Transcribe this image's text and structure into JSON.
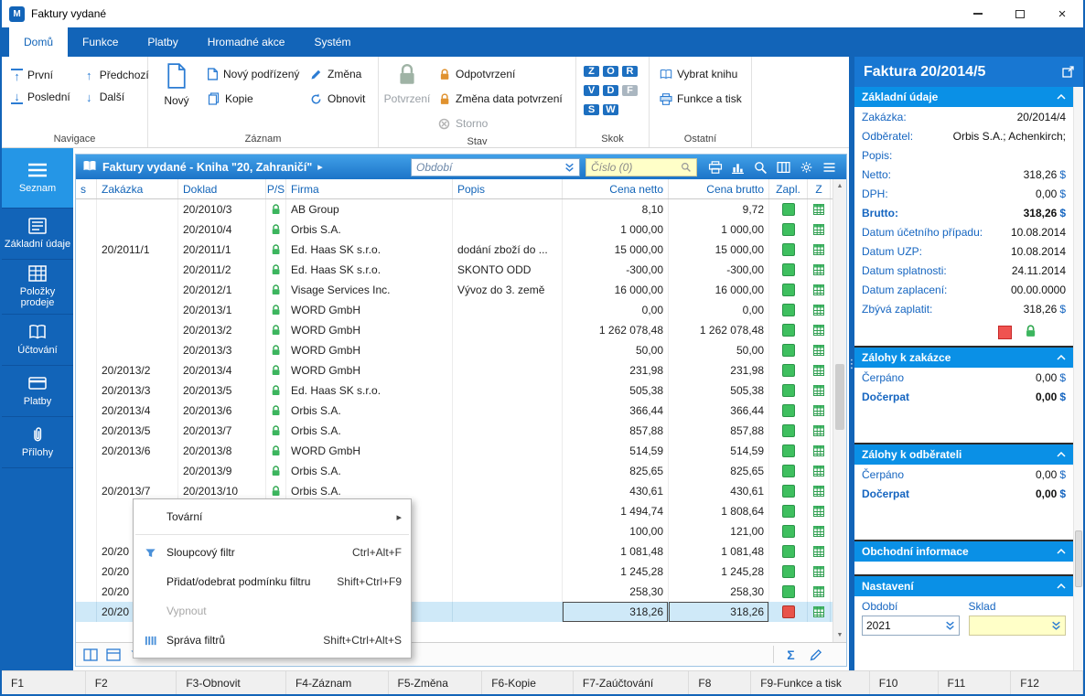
{
  "window": {
    "title": "Faktury vydané",
    "app_icon": "money-app-icon",
    "controls": [
      "minimize-icon",
      "maximize-icon",
      "close-icon"
    ]
  },
  "ribbon_tabs": [
    {
      "label": "Domů",
      "active": true
    },
    {
      "label": "Funkce",
      "active": false
    },
    {
      "label": "Platby",
      "active": false
    },
    {
      "label": "Hromadné akce",
      "active": false
    },
    {
      "label": "Systém",
      "active": false
    }
  ],
  "ribbon": {
    "navigace": {
      "label": "Navigace",
      "prvni": "První",
      "posledni": "Poslední",
      "predchozi": "Předchozí",
      "dalsi": "Další"
    },
    "zaznam": {
      "label": "Záznam",
      "novy": "Nový",
      "novy_podrizeny": "Nový podřízený",
      "kopie": "Kopie",
      "zmena": "Změna",
      "obnovit": "Obnovit"
    },
    "stav": {
      "label": "Stav",
      "potvrzeni": "Potvrzení",
      "odpotvrzeni": "Odpotvrzení",
      "zmena_data": "Změna data potvrzení",
      "storno": "Storno"
    },
    "skok": {
      "label": "Skok",
      "letters": [
        {
          "ch": "Z",
          "disabled": false
        },
        {
          "ch": "O",
          "disabled": false
        },
        {
          "ch": "R",
          "disabled": false
        },
        {
          "ch": "V",
          "disabled": false
        },
        {
          "ch": "D",
          "disabled": false
        },
        {
          "ch": "F",
          "disabled": true
        },
        {
          "ch": "S",
          "disabled": false
        },
        {
          "ch": "W",
          "disabled": false
        }
      ]
    },
    "ostatni": {
      "label": "Ostatní",
      "vybrat_knihu": "Vybrat knihu",
      "funkce_a_tisk": "Funkce a tisk"
    }
  },
  "sidebar": [
    {
      "label": "Seznam",
      "icon": "list-icon",
      "active": true
    },
    {
      "label": "Základní údaje",
      "icon": "form-icon",
      "active": false
    },
    {
      "label": "Položky prodeje",
      "icon": "items-icon",
      "active": false
    },
    {
      "label": "Účtování",
      "icon": "ledger-icon",
      "active": false
    },
    {
      "label": "Platby",
      "icon": "payments-icon",
      "active": false
    },
    {
      "label": "Přílohy",
      "icon": "attachment-icon",
      "active": false
    }
  ],
  "list": {
    "title": "Faktury vydané - Kniha \"20, Zahraničí\"",
    "obdobi_placeholder": "Období",
    "cislo_placeholder": "Číslo (0)",
    "header_icons": [
      "print-icon",
      "chart-icon",
      "find-icon",
      "columns-icon",
      "settings-icon",
      "menu-icon"
    ],
    "columns": [
      "s",
      "Zakázka",
      "Doklad",
      "P/S",
      "Firma",
      "Popis",
      "Cena netto",
      "Cena brutto",
      "Zapl.",
      "Z"
    ],
    "rows": [
      {
        "zakazka": "",
        "doklad": "20/2010/3",
        "locked": true,
        "firma": "AB Group",
        "popis": "",
        "netto": "8,10",
        "brutto": "9,72",
        "zapl": "green",
        "selected": false
      },
      {
        "zakazka": "",
        "doklad": "20/2010/4",
        "locked": true,
        "firma": "Orbis S.A.",
        "popis": "",
        "netto": "1 000,00",
        "brutto": "1 000,00",
        "zapl": "green",
        "selected": false
      },
      {
        "zakazka": "20/2011/1",
        "doklad": "20/2011/1",
        "locked": true,
        "firma": "Ed. Haas SK s.r.o.",
        "popis": "dodání zboží do ...",
        "netto": "15 000,00",
        "brutto": "15 000,00",
        "zapl": "green",
        "selected": false
      },
      {
        "zakazka": "",
        "doklad": "20/2011/2",
        "locked": true,
        "firma": "Ed. Haas SK s.r.o.",
        "popis": "SKONTO ODD",
        "netto": "-300,00",
        "brutto": "-300,00",
        "zapl": "green",
        "selected": false
      },
      {
        "zakazka": "",
        "doklad": "20/2012/1",
        "locked": true,
        "firma": "Visage Services Inc.",
        "popis": "Vývoz do 3. země",
        "netto": "16 000,00",
        "brutto": "16 000,00",
        "zapl": "green",
        "selected": false
      },
      {
        "zakazka": "",
        "doklad": "20/2013/1",
        "locked": true,
        "firma": "WORD GmbH",
        "popis": "",
        "netto": "0,00",
        "brutto": "0,00",
        "zapl": "green",
        "selected": false
      },
      {
        "zakazka": "",
        "doklad": "20/2013/2",
        "locked": true,
        "firma": "WORD GmbH",
        "popis": "",
        "netto": "1 262 078,48",
        "brutto": "1 262 078,48",
        "zapl": "green",
        "selected": false
      },
      {
        "zakazka": "",
        "doklad": "20/2013/3",
        "locked": true,
        "firma": "WORD GmbH",
        "popis": "",
        "netto": "50,00",
        "brutto": "50,00",
        "zapl": "green",
        "selected": false
      },
      {
        "zakazka": "20/2013/2",
        "doklad": "20/2013/4",
        "locked": true,
        "firma": "WORD GmbH",
        "popis": "",
        "netto": "231,98",
        "brutto": "231,98",
        "zapl": "green",
        "selected": false
      },
      {
        "zakazka": "20/2013/3",
        "doklad": "20/2013/5",
        "locked": true,
        "firma": "Ed. Haas SK s.r.o.",
        "popis": "",
        "netto": "505,38",
        "brutto": "505,38",
        "zapl": "green",
        "selected": false
      },
      {
        "zakazka": "20/2013/4",
        "doklad": "20/2013/6",
        "locked": true,
        "firma": "Orbis S.A.",
        "popis": "",
        "netto": "366,44",
        "brutto": "366,44",
        "zapl": "green",
        "selected": false
      },
      {
        "zakazka": "20/2013/5",
        "doklad": "20/2013/7",
        "locked": true,
        "firma": "Orbis S.A.",
        "popis": "",
        "netto": "857,88",
        "brutto": "857,88",
        "zapl": "green",
        "selected": false
      },
      {
        "zakazka": "20/2013/6",
        "doklad": "20/2013/8",
        "locked": true,
        "firma": "WORD GmbH",
        "popis": "",
        "netto": "514,59",
        "brutto": "514,59",
        "zapl": "green",
        "selected": false
      },
      {
        "zakazka": "",
        "doklad": "20/2013/9",
        "locked": true,
        "firma": "Orbis S.A.",
        "popis": "",
        "netto": "825,65",
        "brutto": "825,65",
        "zapl": "green",
        "selected": false
      },
      {
        "zakazka": "20/2013/7",
        "doklad": "20/2013/10",
        "locked": true,
        "firma": "Orbis S.A.",
        "popis": "",
        "netto": "430,61",
        "brutto": "430,61",
        "zapl": "green",
        "selected": false
      },
      {
        "zakazka": "",
        "doklad": "",
        "locked": true,
        "firma": "",
        "popis": "",
        "netto": "1 494,74",
        "brutto": "1 808,64",
        "zapl": "green",
        "selected": false
      },
      {
        "zakazka": "",
        "doklad": "",
        "locked": true,
        "firma": "",
        "popis": "",
        "netto": "100,00",
        "brutto": "121,00",
        "zapl": "green",
        "selected": false
      },
      {
        "zakazka": "20/20",
        "doklad": "",
        "locked": true,
        "firma": "",
        "popis": "",
        "netto": "1 081,48",
        "brutto": "1 081,48",
        "zapl": "green",
        "selected": false
      },
      {
        "zakazka": "20/20",
        "doklad": "",
        "locked": true,
        "firma": "",
        "popis": "",
        "netto": "1 245,28",
        "brutto": "1 245,28",
        "zapl": "green",
        "selected": false
      },
      {
        "zakazka": "20/20",
        "doklad": "",
        "locked": true,
        "firma": "",
        "popis": "",
        "netto": "258,30",
        "brutto": "258,30",
        "zapl": "green",
        "selected": false
      },
      {
        "zakazka": "20/20",
        "doklad": "",
        "locked": true,
        "firma": "",
        "popis": "",
        "netto": "318,26",
        "brutto": "318,26",
        "zapl": "red",
        "selected": true
      }
    ],
    "footer_icons": [
      "view-columns-icon",
      "card-view-icon",
      "filter-icon"
    ],
    "footer_right_icons": [
      "sum-icon",
      "edit-icon"
    ]
  },
  "context_menu": {
    "items": [
      {
        "label": "Tovární",
        "submenu": true
      },
      {
        "separator": true
      },
      {
        "label": "Sloupcový filtr",
        "shortcut": "Ctrl+Alt+F",
        "icon": "filter-icon"
      },
      {
        "label": "Přidat/odebrat podmínku filtru",
        "shortcut": "Shift+Ctrl+F9"
      },
      {
        "label": "Vypnout",
        "disabled": true
      },
      {
        "label": "Správa filtrů",
        "shortcut": "Shift+Ctrl+Alt+S",
        "icon": "filter-manage-icon"
      }
    ]
  },
  "panel": {
    "title": "Faktura 20/2014/5",
    "zakladni_udaje": {
      "header": "Základní údaje",
      "fields": [
        {
          "label": "Zakázka:",
          "value": "20/2014/4"
        },
        {
          "label": "Odběratel:",
          "value": "Orbis S.A.; Achenkirch;"
        },
        {
          "label": "Popis:",
          "value": ""
        },
        {
          "label": "Netto:",
          "value": "318,26",
          "currency": "$"
        },
        {
          "label": "DPH:",
          "value": "0,00",
          "currency": "$"
        },
        {
          "label": "Brutto:",
          "value": "318,26",
          "currency": "$",
          "bold": true
        },
        {
          "label": "Datum účetního případu:",
          "value": "10.08.2014"
        },
        {
          "label": "Datum UZP:",
          "value": "10.08.2014"
        },
        {
          "label": "Datum splatnosti:",
          "value": "24.11.2014"
        },
        {
          "label": "Datum zaplacení:",
          "value": "00.00.0000"
        },
        {
          "label": "Zbývá zaplatit:",
          "value": "318,26",
          "currency": "$"
        }
      ],
      "status_icons": [
        "unpaid-indicator",
        "confirmed-lock-icon"
      ]
    },
    "zalohy_k_zakazce": {
      "header": "Zálohy k zakázce",
      "fields": [
        {
          "label": "Čerpáno",
          "value": "0,00",
          "currency": "$"
        },
        {
          "label": "Dočerpat",
          "value": "0,00",
          "currency": "$",
          "bold": true
        }
      ]
    },
    "zalohy_k_odberateli": {
      "header": "Zálohy k odběrateli",
      "fields": [
        {
          "label": "Čerpáno",
          "value": "0,00",
          "currency": "$"
        },
        {
          "label": "Dočerpat",
          "value": "0,00",
          "currency": "$",
          "bold": true
        }
      ]
    },
    "obchodni_informace": {
      "header": "Obchodní informace"
    },
    "nastaveni": {
      "header": "Nastavení",
      "obdobi_label": "Období",
      "obdobi_value": "2021",
      "sklad_label": "Sklad",
      "sklad_value": ""
    }
  },
  "statusbar": [
    "F1",
    "F2",
    "F3-Obnovit",
    "F4-Záznam",
    "F5-Změna",
    "F6-Kopie",
    "F7-Zaúčtování",
    "F8",
    "F9-Funkce a tisk",
    "F10",
    "F11",
    "F12"
  ]
}
